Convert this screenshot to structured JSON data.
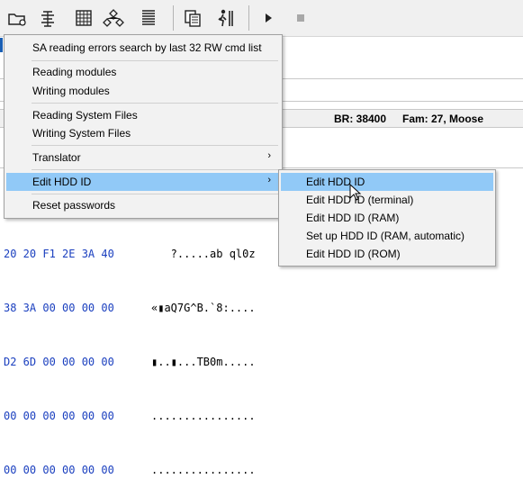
{
  "status_bar": {
    "br": "BR: 38400",
    "fam": "Fam: 27, Moose"
  },
  "hex_rows": [
    {
      "hex": "20 20 F1 2E 3A 40",
      "ascii": "   ?.....ab ql0z"
    },
    {
      "hex": "38 3A 00 00 00 00",
      "ascii": "«▮aQ7G^B.`8:...."
    },
    {
      "hex": "D2 6D 00 00 00 00",
      "ascii": "▮..▮...TB0m....."
    },
    {
      "hex": "00 00 00 00 00 00",
      "ascii": "................"
    },
    {
      "hex": "00 00 00 00 00 00",
      "ascii": "................"
    }
  ],
  "menu": {
    "items": [
      {
        "label": "SA reading errors search by last 32 RW cmd list"
      },
      {
        "label": "Reading modules"
      },
      {
        "label": "Writing modules"
      },
      {
        "label": "Reading System Files"
      },
      {
        "label": "Writing System Files"
      },
      {
        "label": "Translator",
        "arrow": "›"
      },
      {
        "label": "Edit HDD ID",
        "arrow": "›"
      },
      {
        "label": "Reset passwords"
      }
    ]
  },
  "submenu": {
    "items": [
      {
        "label": "Edit HDD ID"
      },
      {
        "label": "Edit HDD ID (terminal)"
      },
      {
        "label": "Edit HDD ID (RAM)"
      },
      {
        "label": "Set up HDD ID (RAM, automatic)"
      },
      {
        "label": "Edit HDD ID (ROM)"
      }
    ]
  },
  "toolbar_icons": [
    "folder-gear-icon",
    "chip-icon",
    "grid-icon",
    "network-icon",
    "list-icon",
    "copy-icon",
    "person-exit-icon",
    "play-icon",
    "stop-icon"
  ],
  "colors": {
    "highlight": "#91c9f7",
    "menu_bg": "#f2f2f2",
    "hex_blue": "#1a3fbf"
  }
}
